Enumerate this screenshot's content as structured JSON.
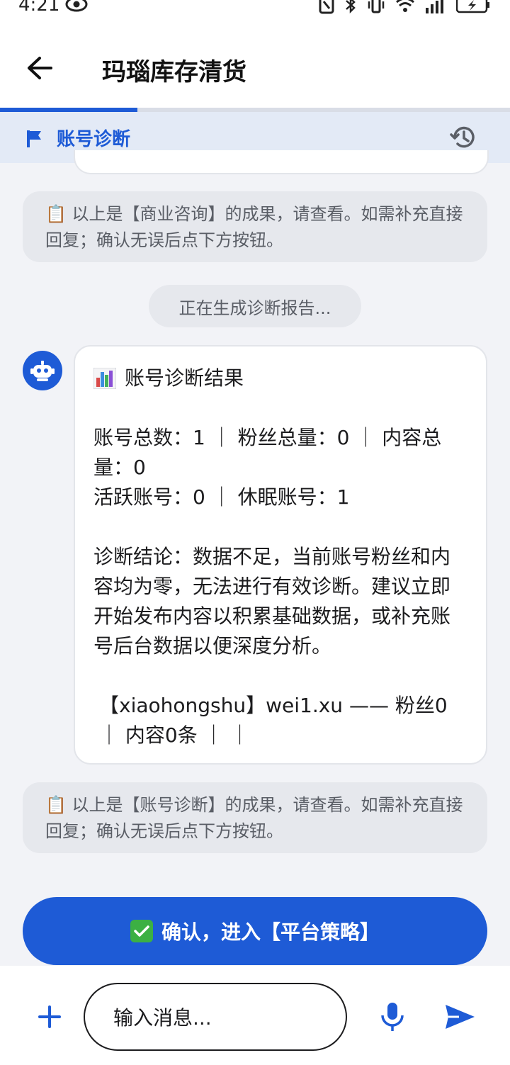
{
  "status_bar": {
    "time": "4:21"
  },
  "header": {
    "title": "玛瑙库存清货",
    "progress_fraction": 0.27
  },
  "stage": {
    "label": "账号诊断"
  },
  "messages": {
    "note1": "📋 以上是【商业咨询】的成果，请查看。如需补充直接回复；确认无误后点下方按钮。",
    "generating": "正在生成诊断报告...",
    "diagnosis": {
      "title": "账号诊断结果",
      "line1": "账号总数：1 ｜ 粉丝总量：0 ｜ 内容总量：0",
      "line2": "活跃账号：0 ｜ 休眠账号：1",
      "conclusion": "诊断结论：数据不足，当前账号粉丝和内容均为零，无法进行有效诊断。建议立即开始发布内容以积累基础数据，或补充账号后台数据以便深度分析。",
      "account_line": "【xiaohongshu】wei1.xu —— 粉丝0 ｜ 内容0条 ｜ ｜"
    },
    "note2": "📋 以上是【账号诊断】的成果，请查看。如需补充直接回复；确认无误后点下方按钮。"
  },
  "confirm_button": {
    "label": "确认，进入【平台策略】"
  },
  "input": {
    "placeholder": "输入消息..."
  },
  "colors": {
    "accent": "#1e5bd6",
    "background": "#f2f3f7",
    "note_bg": "#e6e8ed",
    "check": "#3cb043"
  }
}
